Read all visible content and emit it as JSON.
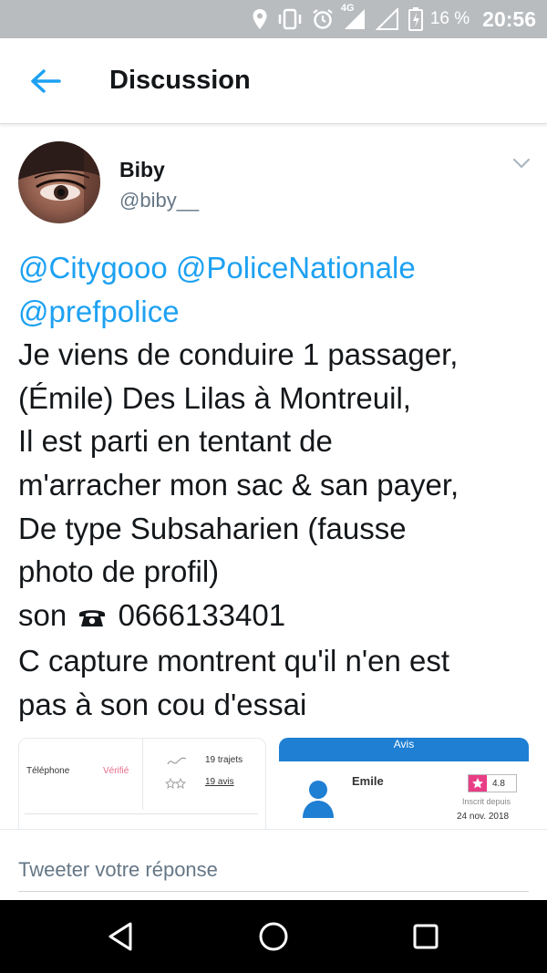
{
  "status_bar": {
    "network": "4G",
    "battery": "16 %",
    "time": "20:56",
    "icons": [
      "location-icon",
      "vibrate-icon",
      "alarm-icon",
      "signal-icon",
      "signal-empty-icon",
      "battery-icon"
    ]
  },
  "app_bar": {
    "title": "Discussion",
    "back_icon": "arrow-left-icon",
    "accent_color": "#1da1f2"
  },
  "tweet": {
    "author_name": "Biby",
    "author_handle": "@biby__",
    "text": {
      "line1_mention1": "@Citygooo",
      "line1_mention2": "@PoliceNationale",
      "line2_mention": "@prefpolice",
      "line3": "Je viens de conduire 1 passager,",
      "line4": "(Émile) Des Lilas à Montreuil,",
      "line5": "Il est parti en tentant de",
      "line6": "m'arracher mon sac & san payer,",
      "line7": "De type Subsaharien (fausse",
      "line8": "photo de profil)",
      "line9_prefix": "son",
      "line9_phone": "0666133401",
      "line10": "C capture montrent qu'il n'en est",
      "line11": "pas à son cou d'essai"
    },
    "media": [
      {
        "telephone_label": "Téléphone",
        "verified_label": "Vérifié",
        "trips": "19 trajets",
        "reviews": "19 avis"
      },
      {
        "header": "Avis",
        "name": "Emile",
        "rating": "4.8",
        "member_since_label": "Inscrit depuis",
        "member_since_date": "24 nov. 2018"
      }
    ]
  },
  "reply": {
    "placeholder": "Tweeter votre réponse"
  },
  "nav_bar": {
    "icons": [
      "back-triangle-icon",
      "home-circle-icon",
      "recents-square-icon"
    ]
  }
}
